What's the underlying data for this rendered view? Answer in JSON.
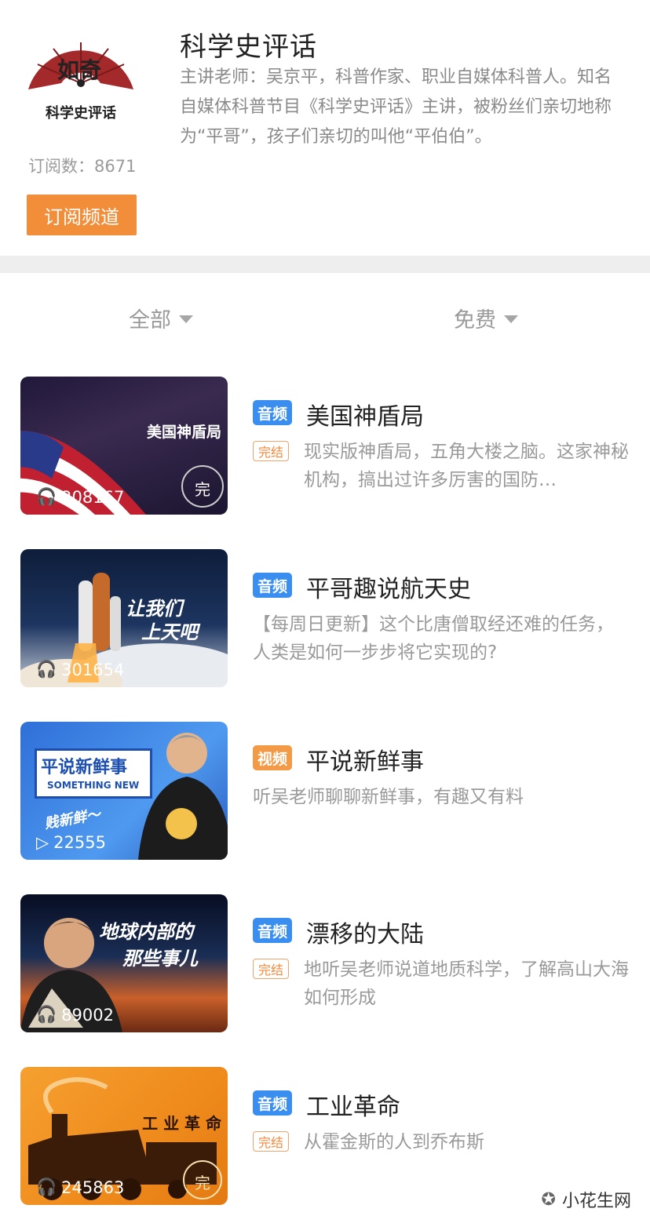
{
  "channel": {
    "logo_text": "科学史评话",
    "title": "科学史评话",
    "description": "主讲老师：吴京平，科普作家、职业自媒体科普人。知名自媒体科普节目《科学史评话》主讲，被粉丝们亲切地称为“平哥”，孩子们亲切的叫他“平伯伯”。",
    "subscribers": "订阅数：8671",
    "subscribe_label": "订阅频道"
  },
  "filters": {
    "category": "全部",
    "price": "免费"
  },
  "items": [
    {
      "type": "音频",
      "title": "美国神盾局",
      "done": "完结",
      "desc": "现实版神盾局，五角大楼之脑。这家神秘机构，搞出过许多厉害的国防…",
      "thumb_text": "美国神盾局",
      "plays": "208167"
    },
    {
      "type": "音频",
      "title": "平哥趣说航天史",
      "done": "",
      "desc": "【每周日更新】这个比唐僧取经还难的任务，人类是如何一步步将它实现的?",
      "thumb_text1": "让我们",
      "thumb_text2": "上天吧",
      "plays": "301654"
    },
    {
      "type": "视频",
      "title": "平说新鲜事",
      "done": "",
      "desc": "听吴老师聊聊新鲜事，有趣又有料",
      "thumb_text1": "平说新鲜事",
      "thumb_text2": "SOMETHING NEW",
      "thumb_text3": "贱新鲜～",
      "plays": "22555"
    },
    {
      "type": "音频",
      "title": "漂移的大陆",
      "done": "完结",
      "desc": "地听吴老师说道地质科学，了解高山大海如何形成",
      "thumb_text1": "地球内部的",
      "thumb_text2": "那些事儿",
      "plays": "89002"
    },
    {
      "type": "音频",
      "title": "工业革命",
      "done": "完结",
      "desc": "从霍金斯的人到乔布斯",
      "thumb_text": "工 业 革 命",
      "plays": "245863"
    }
  ],
  "watermark": "小花生网",
  "colors": {
    "accent": "#f28d39",
    "audio_badge": "#3a8ef0",
    "video_badge": "#f29a45"
  }
}
